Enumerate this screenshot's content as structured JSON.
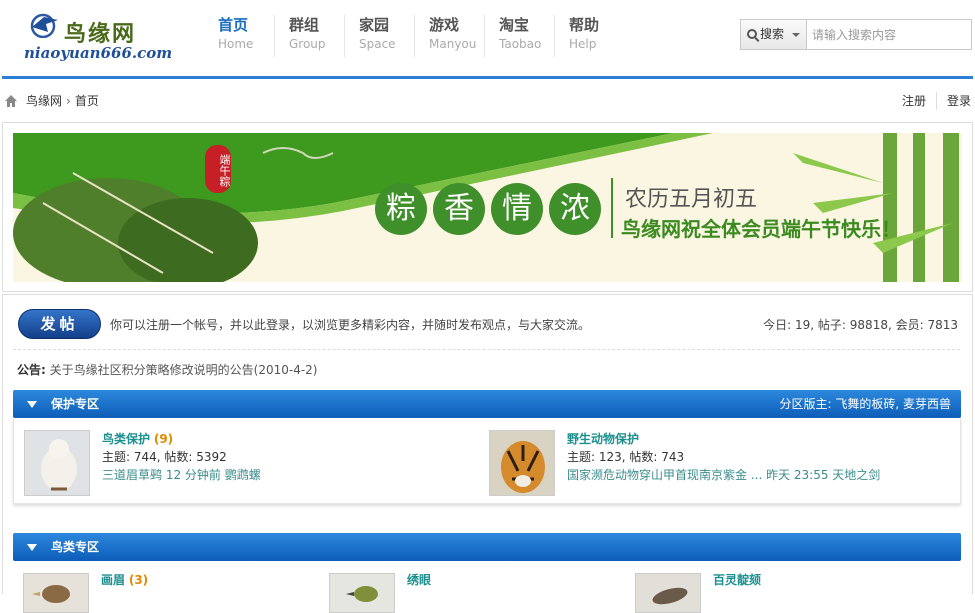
{
  "logo": {
    "name": "鸟缘网",
    "url": "niaoyuan666.com"
  },
  "nav": [
    {
      "cn": "首页",
      "en": "Home",
      "active": true
    },
    {
      "cn": "群组",
      "en": "Group"
    },
    {
      "cn": "家园",
      "en": "Space"
    },
    {
      "cn": "游戏",
      "en": "Manyou"
    },
    {
      "cn": "淘宝",
      "en": "Taobao"
    },
    {
      "cn": "帮助",
      "en": "Help"
    }
  ],
  "search": {
    "type_label": "搜索",
    "placeholder": "请输入搜索内容"
  },
  "breadcrumb": {
    "site": "鸟缘网",
    "sep": "›",
    "current": "首页"
  },
  "user_links": {
    "register": "注册",
    "login": "登录"
  },
  "banner": {
    "stamp": "端午粽",
    "chars": [
      "粽",
      "香",
      "情",
      "浓"
    ],
    "lunar": "农历五月初五",
    "greeting": "鸟缘网祝全体会员端午节快乐！"
  },
  "post_button": "发帖",
  "notice": "你可以注册一个帐号，并以此登录，以浏览更多精彩内容，并随时发布观点，与大家交流。",
  "stats": "今日: 19, 帖子: 98818, 会员: 7813",
  "announcement": {
    "label": "公告:",
    "text": "关于鸟缘社区积分策略修改说明的公告",
    "date": "(2010-4-2)"
  },
  "sections": [
    {
      "title": "保护专区",
      "mods": "分区版主: 飞舞的板砖, 麦芽西兽",
      "forums": [
        {
          "name": "鸟类保护",
          "today": "(9)",
          "stats": "主题: 744, 帖数: 5392",
          "last": "三道眉草鹀 12 分钟前 鹦鹉螺"
        },
        {
          "name": "野生动物保护",
          "today": "",
          "stats": "主题: 123, 帖数: 743",
          "last": "国家濒危动物穿山甲首现南京紫金 ... 昨天 23:55 天地之剑"
        }
      ]
    },
    {
      "title": "鸟类专区",
      "mods": "",
      "forums": [
        {
          "name": "画眉",
          "today": "(3)"
        },
        {
          "name": "绣眼",
          "today": ""
        },
        {
          "name": "百灵靛颏",
          "today": ""
        }
      ]
    }
  ],
  "colors": {
    "accent": "#2e7ed5",
    "forum_name": "#1c8f8f",
    "count": "#e08a00",
    "banner_green": "#3f8f2a"
  }
}
